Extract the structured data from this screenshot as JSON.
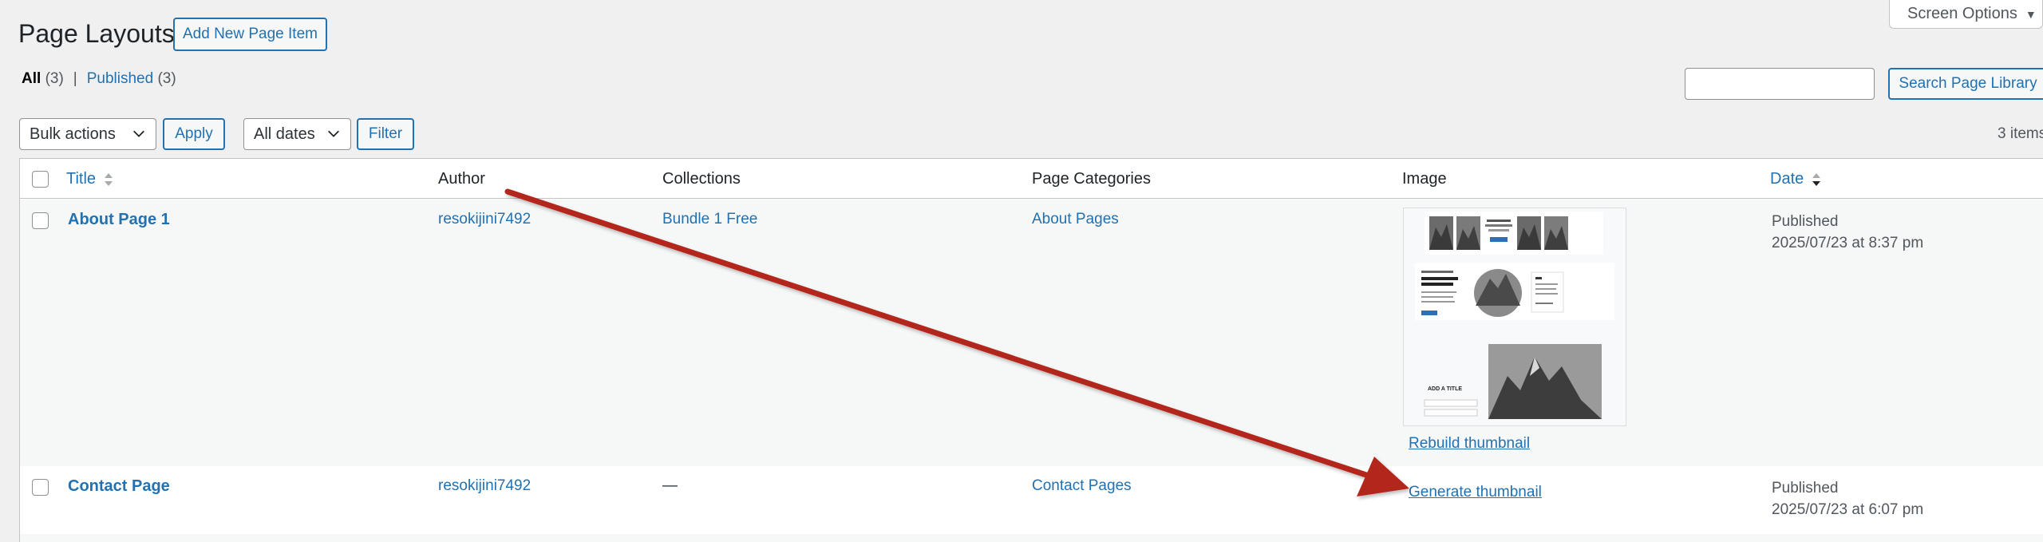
{
  "header": {
    "screen_options": "Screen Options",
    "title": "Page Layouts",
    "add_new": "Add New Page Item"
  },
  "filters": {
    "all_label": "All",
    "all_count": "(3)",
    "separator": "|",
    "published_label": "Published",
    "published_count": "(3)"
  },
  "search": {
    "button": "Search Page Library",
    "value": ""
  },
  "toolbar": {
    "bulk_actions": "Bulk actions",
    "apply": "Apply",
    "dates": "All dates",
    "filter": "Filter",
    "items_count": "3 items"
  },
  "table": {
    "columns": {
      "title": "Title",
      "author": "Author",
      "collections": "Collections",
      "categories": "Page Categories",
      "image": "Image",
      "date": "Date"
    },
    "rows": [
      {
        "title": "About Page 1",
        "author": "resokijini7492",
        "collection": "Bundle 1 Free",
        "category": "About Pages",
        "image_action": "Rebuild thumbnail",
        "status": "Published",
        "date": "2025/07/23 at 8:37 pm"
      },
      {
        "title": "Contact Page",
        "author": "resokijini7492",
        "collection": "—",
        "category": "Contact Pages",
        "image_action": "Generate thumbnail",
        "status": "Published",
        "date": "2025/07/23 at 6:07 pm"
      }
    ]
  },
  "thumbnail_text": {
    "add_title": "ADD A TITLE"
  },
  "colors": {
    "link": "#2271b1",
    "arrow": "#b3261e",
    "background": "#f0f0f1"
  }
}
